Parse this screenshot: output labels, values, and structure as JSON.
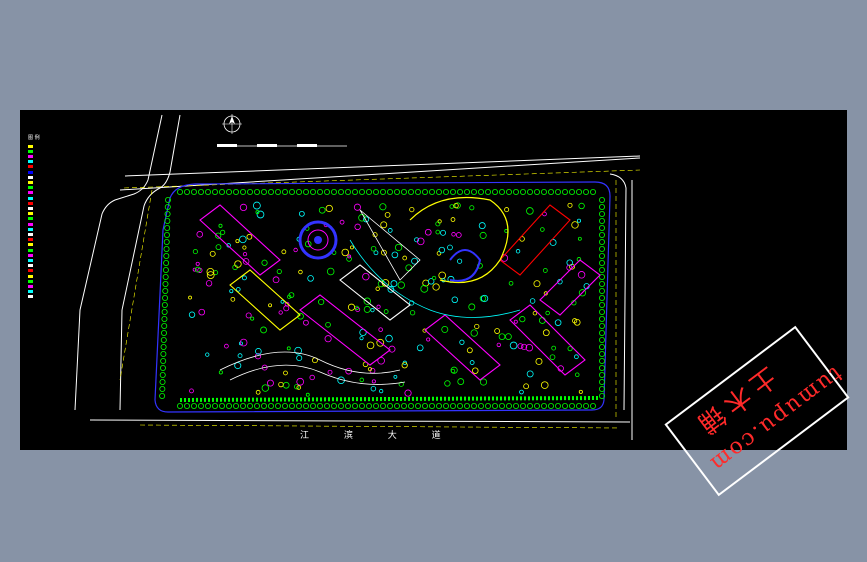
{
  "legend": {
    "title": "图 例",
    "items": [
      {
        "label": "",
        "color": "#ffff00"
      },
      {
        "label": "",
        "color": "#00ff00"
      },
      {
        "label": "",
        "color": "#ff00ff"
      },
      {
        "label": "",
        "color": "#00ffff"
      },
      {
        "label": "",
        "color": "#ff0000"
      },
      {
        "label": "",
        "color": "#0000ff"
      },
      {
        "label": "",
        "color": "#ffffff"
      },
      {
        "label": "",
        "color": "#ffff00"
      },
      {
        "label": "",
        "color": "#00ff00"
      },
      {
        "label": "",
        "color": "#ff00ff"
      },
      {
        "label": "",
        "color": "#00ffff"
      },
      {
        "label": "",
        "color": "#ff0000"
      },
      {
        "label": "",
        "color": "#ffffff"
      },
      {
        "label": "",
        "color": "#ffff00"
      },
      {
        "label": "",
        "color": "#00ff00"
      },
      {
        "label": "",
        "color": "#ff00ff"
      },
      {
        "label": "",
        "color": "#00ffff"
      },
      {
        "label": "",
        "color": "#ffffff"
      },
      {
        "label": "",
        "color": "#ff0000"
      },
      {
        "label": "",
        "color": "#ffff00"
      },
      {
        "label": "",
        "color": "#00ff00"
      },
      {
        "label": "",
        "color": "#ff00ff"
      },
      {
        "label": "",
        "color": "#00ffff"
      },
      {
        "label": "",
        "color": "#ffffff"
      },
      {
        "label": "",
        "color": "#ff0000"
      },
      {
        "label": "",
        "color": "#ffff00"
      },
      {
        "label": "",
        "color": "#00ff00"
      },
      {
        "label": "",
        "color": "#ff00ff"
      },
      {
        "label": "",
        "color": "#00ffff"
      },
      {
        "label": "",
        "color": "#ffffff"
      }
    ]
  },
  "roads": {
    "south": "江 滨 大 道"
  },
  "watermark": {
    "chinese": "土木铺",
    "url": "tumupu.com"
  },
  "colors": {
    "background": "#8793a6",
    "canvas": "#000000",
    "road_line": "#ffffff",
    "road_center": "#ffff00",
    "boundary": "#3333ff",
    "trees": "#00ff00",
    "buildings": "#ff00ff",
    "paths": "#ffff00",
    "water": "#3333ff",
    "watermark": "#ff2a2a"
  }
}
